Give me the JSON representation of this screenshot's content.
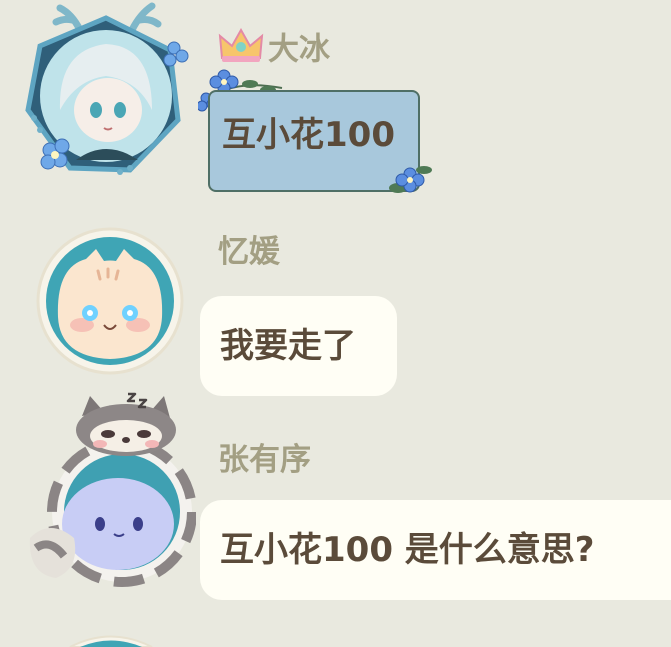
{
  "messages": [
    {
      "sender": "大冰",
      "text": "互小花100",
      "badge_icon": "crown-icon",
      "bubble_style": "blue-flower-frame",
      "avatar": "avatar-dabing"
    },
    {
      "sender": "忆媛",
      "text": "我要走了",
      "bubble_style": "plain",
      "avatar": "avatar-yiyuan"
    },
    {
      "sender": "张有序",
      "text": "互小花100  是什么意思?",
      "bubble_style": "plain",
      "avatar": "avatar-zhangyouxu"
    }
  ],
  "colors": {
    "background": "#e9e9df",
    "name_text": "#a39f83",
    "message_text": "#5b4b3a",
    "bubble_plain": "#fffef5",
    "bubble_special": "#a8c8dc"
  }
}
